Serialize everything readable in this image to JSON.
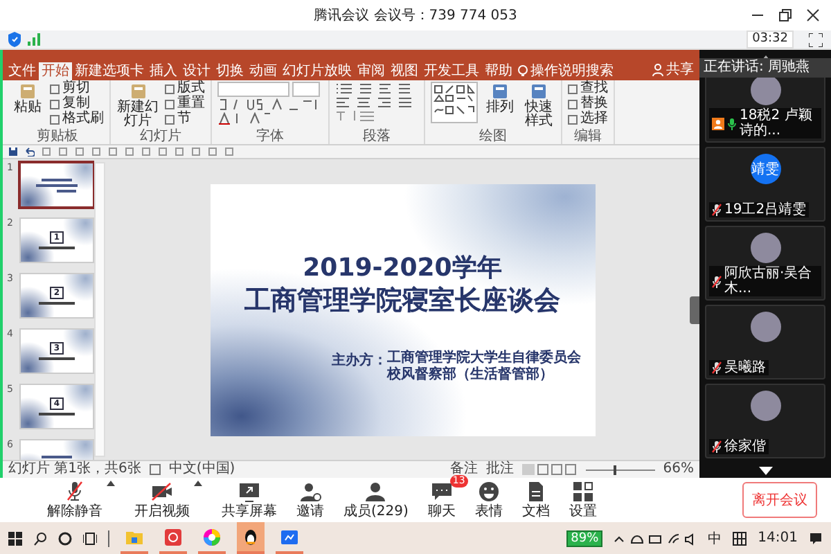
{
  "window": {
    "title": "腾讯会议 会议号：739 774 053"
  },
  "info_bar": {
    "timer": "03:32"
  },
  "powerpoint": {
    "tabs": [
      {
        "label": "文件",
        "selected": false
      },
      {
        "label": "开始",
        "selected": true
      },
      {
        "label": "新建选项卡",
        "selected": false
      },
      {
        "label": "插入",
        "selected": false
      },
      {
        "label": "设计",
        "selected": false
      },
      {
        "label": "切换",
        "selected": false
      },
      {
        "label": "动画",
        "selected": false
      },
      {
        "label": "幻灯片放映",
        "selected": false
      },
      {
        "label": "审阅",
        "selected": false
      },
      {
        "label": "视图",
        "selected": false
      },
      {
        "label": "开发工具",
        "selected": false
      },
      {
        "label": "帮助",
        "selected": false
      },
      {
        "label": "操作说明搜索",
        "selected": false,
        "kind": "search"
      }
    ],
    "share_label": "共享",
    "ribbon_groups": [
      {
        "label": "剪贴板",
        "kind": "buttons",
        "large": [
          "粘贴"
        ],
        "small": [
          "剪切",
          "复制",
          "格式刷"
        ]
      },
      {
        "label": "幻灯片",
        "kind": "buttons",
        "large": [
          "新建幻灯片"
        ],
        "small": [
          "版式",
          "重置",
          "节"
        ]
      },
      {
        "label": "字体",
        "kind": "font"
      },
      {
        "label": "段落",
        "kind": "paragraph"
      },
      {
        "label": "绘图",
        "kind": "drawing",
        "large": [
          "排列",
          "快速样式"
        ]
      },
      {
        "label": "编辑",
        "kind": "buttons",
        "small": [
          "查找",
          "替换",
          "选择"
        ]
      }
    ],
    "slides": [
      {
        "number": "1",
        "selected": true,
        "kind": "title"
      },
      {
        "number": "2",
        "selected": false,
        "kind": "section",
        "section": "1"
      },
      {
        "number": "3",
        "selected": false,
        "kind": "section",
        "section": "2"
      },
      {
        "number": "4",
        "selected": false,
        "kind": "section",
        "section": "3"
      },
      {
        "number": "5",
        "selected": false,
        "kind": "section",
        "section": "4"
      },
      {
        "number": "6",
        "selected": false,
        "kind": "title"
      }
    ],
    "current_slide": {
      "title": "2019-2020学年",
      "subtitle": "工商管理学院寝室长座谈会",
      "organizer_label": "主办方：",
      "organizer_lines": [
        "工商管理学院大学生自律委员会",
        "校风督察部（生活督管部）"
      ]
    },
    "status_bar": {
      "slide_info": "幻灯片 第1张，共6张",
      "language": "中文(中国)",
      "notes": "备注",
      "comments": "批注",
      "zoom": "66%",
      "zoom_slider": {
        "level": 0.4
      }
    }
  },
  "participants": {
    "speaking": "正在讲话: 周驰燕",
    "tiles": [
      {
        "name": "18税2 卢颖诗的...",
        "kind": "photo",
        "muted": false,
        "host": true
      },
      {
        "name": "19工2吕靖雯",
        "kind": "text",
        "avatar_text": "靖雯",
        "muted": true,
        "host": false
      },
      {
        "name": "阿欣古丽·吴合木...",
        "kind": "photo",
        "muted": true,
        "host": false
      },
      {
        "name": "吴曦路",
        "kind": "photo",
        "muted": true,
        "host": false
      },
      {
        "name": "徐家偕",
        "kind": "photo",
        "muted": true,
        "host": false
      }
    ]
  },
  "toolbar": {
    "buttons": [
      {
        "label": "解除静音",
        "kind": "mic",
        "menu": true
      },
      {
        "label": "开启视频",
        "kind": "video",
        "menu": true
      },
      {
        "label": "共享屏幕",
        "kind": "share"
      },
      {
        "label": "邀请",
        "kind": "invite"
      },
      {
        "label": "成员(229)",
        "kind": "members"
      },
      {
        "label": "聊天",
        "kind": "chat",
        "badge": "13"
      },
      {
        "label": "表情",
        "kind": "emoji"
      },
      {
        "label": "文档",
        "kind": "doc"
      },
      {
        "label": "设置",
        "kind": "settings"
      }
    ],
    "leave": "离开会议"
  },
  "taskbar": {
    "apps": [
      {
        "kind": "folder",
        "active": false
      },
      {
        "kind": "red-app",
        "active": false
      },
      {
        "kind": "color-wheel",
        "active": false
      },
      {
        "kind": "penguin",
        "active": true
      },
      {
        "kind": "blue-app",
        "active": false
      }
    ],
    "battery": "89%",
    "ime": "中",
    "time": "14:01"
  }
}
